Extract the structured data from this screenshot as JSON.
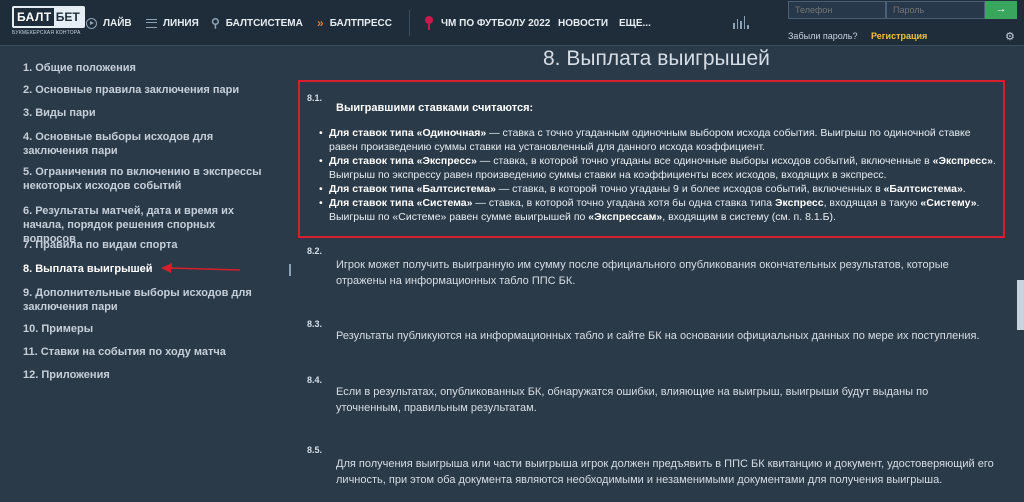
{
  "header": {
    "logo": {
      "a": "БАЛТ",
      "b": "БЕТ",
      "sub": "БУКМЕКЕРСКАЯ КОНТОРА"
    },
    "nav": [
      {
        "label": "ЛАЙВ",
        "icon": "live-play-icon"
      },
      {
        "label": "ЛИНИЯ",
        "icon": "list-lines-icon"
      },
      {
        "label": "БАЛТСИСТЕМА",
        "icon": "rocket-icon"
      },
      {
        "label": "БАЛТПРЕСС",
        "icon": "express-arrows-icon"
      }
    ],
    "wc_label": "ЧМ ПО ФУТБОЛУ 2022",
    "news_label": "НОВОСТИ",
    "more_label": "ЕЩЕ...",
    "phone_placeholder": "Телефон",
    "password_placeholder": "Пароль",
    "go_label": "→",
    "forgot_label": "Забыли пароль?",
    "register_label": "Регистрация",
    "settings_label": "⚙"
  },
  "sidebar": {
    "items": [
      {
        "label": "1. Общие положения"
      },
      {
        "label": "2. Основные правила заключения пари"
      },
      {
        "label": "3. Виды пари"
      },
      {
        "label": "4. Основные выборы исходов для заключения пари"
      },
      {
        "label": "5. Ограничения по включению в экспрессы некоторых исходов событий"
      },
      {
        "label": "6. Результаты матчей, дата и время их начала, порядок решения спорных вопросов"
      },
      {
        "label": "7. Правила по видам спорта"
      },
      {
        "label": "8. Выплата выигрышей"
      },
      {
        "label": "9. Дополнительные выборы исходов для заключения пари"
      },
      {
        "label": "10. Примеры"
      },
      {
        "label": "11. Ставки на события по ходу матча"
      },
      {
        "label": "12. Приложения"
      }
    ],
    "active_index": 7
  },
  "main": {
    "title": "8. Выплата выигрышей",
    "s81": {
      "num": "8.1.",
      "title": "Выигравшими ставками считаются:",
      "b1": {
        "bold": "Для ставок типа «Одиночная»",
        "text": " — ставка с точно угаданным одиночным выбором исхода события. Выигрыш по одиночной ставке равен произведению суммы ставки на установленный для данного исхода коэффициент."
      },
      "b2": {
        "bold": "Для ставок типа «Экспресс»",
        "t1": " — ставка, в которой точно угаданы все одиночные выборы исходов событий, включенные в ",
        "b2": "«Экспресс»",
        "t2": ". Выигрыш по экспрессу равен произведению суммы ставки на коэффициенты всех исходов, входящих в экспресс."
      },
      "b3": {
        "bold": "Для ставок типа «Балтсистема»",
        "t1": " — ставка, в которой точно угаданы 9 и более исходов событий, включенных в ",
        "b2": "«Балтсистема»",
        "t2": "."
      },
      "b4": {
        "bold": "Для ставок типа «Система»",
        "t1": " — ставка, в которой точно угадана хотя бы одна ставка типа ",
        "b2": "Экспресс",
        "t2": ", входящая в такую ",
        "b3": "«Систему»",
        "t3": ". Выигрыш по «Системе» равен сумме выигрышей по ",
        "b4": "«Экспрессам»",
        "t4": ", входящим в систему (см. п. 8.1.Б)."
      }
    },
    "s82": {
      "num": "8.2.",
      "text": "Игрок может получить выигранную им сумму после официального опубликования окончательных результатов, которые отражены на информационных табло ППС БК."
    },
    "s83": {
      "num": "8.3.",
      "text": "Результаты публикуются на информационных табло и сайте БК на основании официальных данных по мере их поступления."
    },
    "s84": {
      "num": "8.4.",
      "text": "Если в результатах, опубликованных БК, обнаружатся ошибки, влияющие на выигрыш, выигрыши будут выданы по уточненным, правильным результатам."
    },
    "s85": {
      "num": "8.5.",
      "text": "Для получения выигрыша или части выигрыша игрок должен предъявить в ППС БК квитанцию и документ, удостоверяющий его личность, при этом оба документа являются необходимыми и незаменимыми документами для получения выигрыша."
    }
  },
  "colors": {
    "background": "#2b3a49",
    "header": "#1f2d3a",
    "highlight_border": "#d61f2a",
    "register": "#f3c13a",
    "go_button": "#3aa55c",
    "accent_red": "#c8184d",
    "express_orange": "#e8762c"
  }
}
